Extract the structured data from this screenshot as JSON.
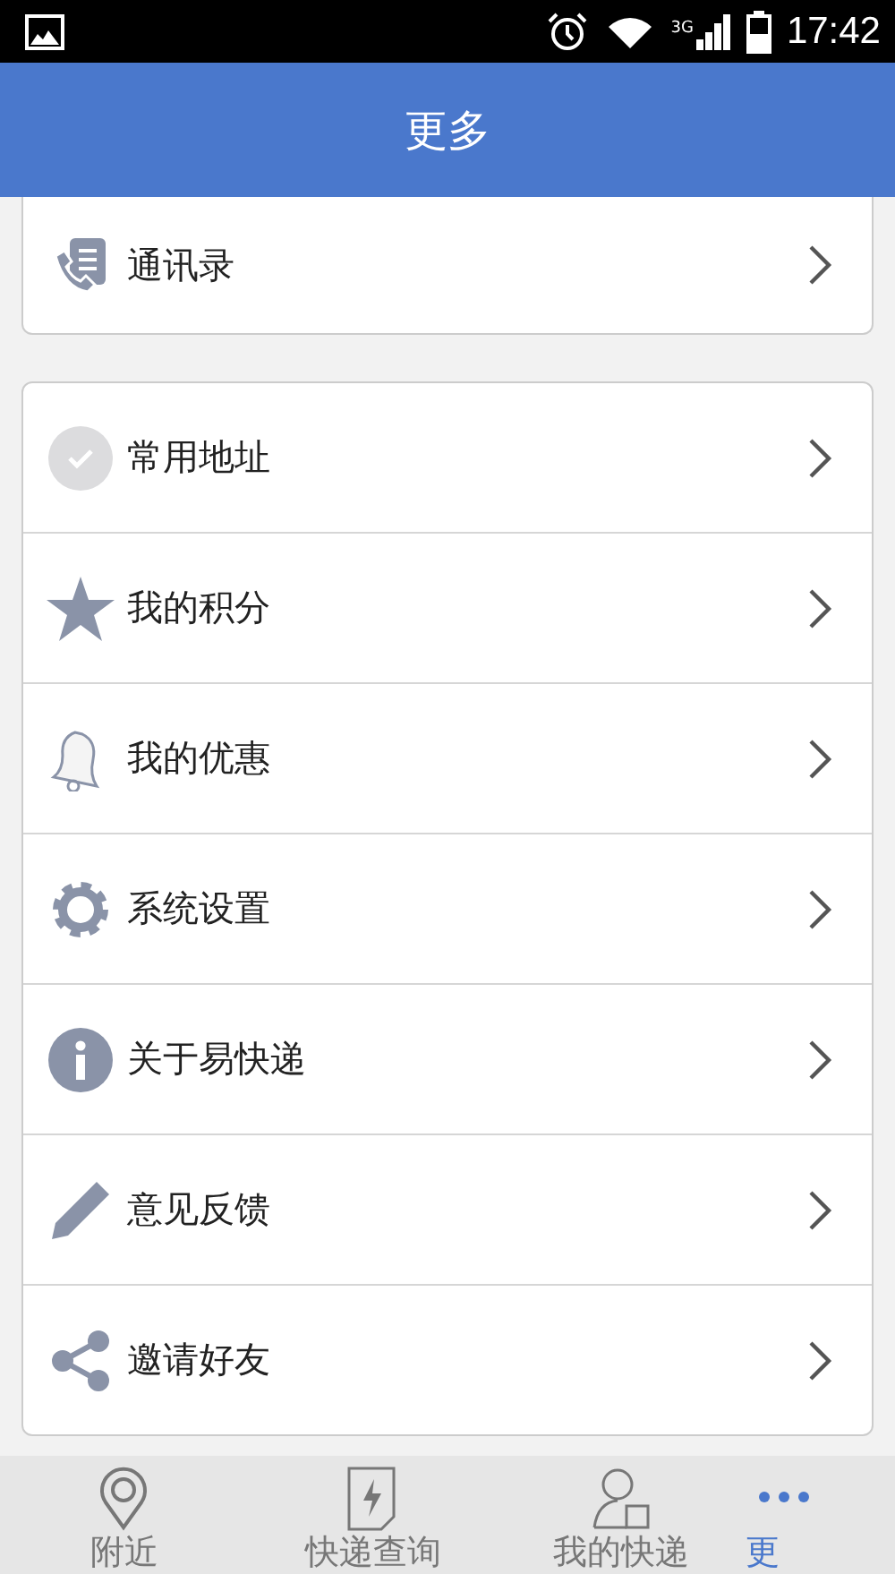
{
  "status_bar": {
    "time": "17:42",
    "network": "3G"
  },
  "header": {
    "title": "更多"
  },
  "groups": [
    {
      "items": [
        {
          "label": "通讯录"
        }
      ]
    },
    {
      "items": [
        {
          "label": "常用地址"
        },
        {
          "label": "我的积分"
        },
        {
          "label": "我的优惠"
        },
        {
          "label": "系统设置"
        },
        {
          "label": "关于易快递"
        },
        {
          "label": "意见反馈"
        },
        {
          "label": "邀请好友"
        }
      ]
    }
  ],
  "tab_bar": [
    {
      "label": "附近",
      "selected": false
    },
    {
      "label": "快递查询",
      "selected": false
    },
    {
      "label": "我的快递",
      "selected": false
    },
    {
      "label": "更",
      "selected": true
    }
  ]
}
